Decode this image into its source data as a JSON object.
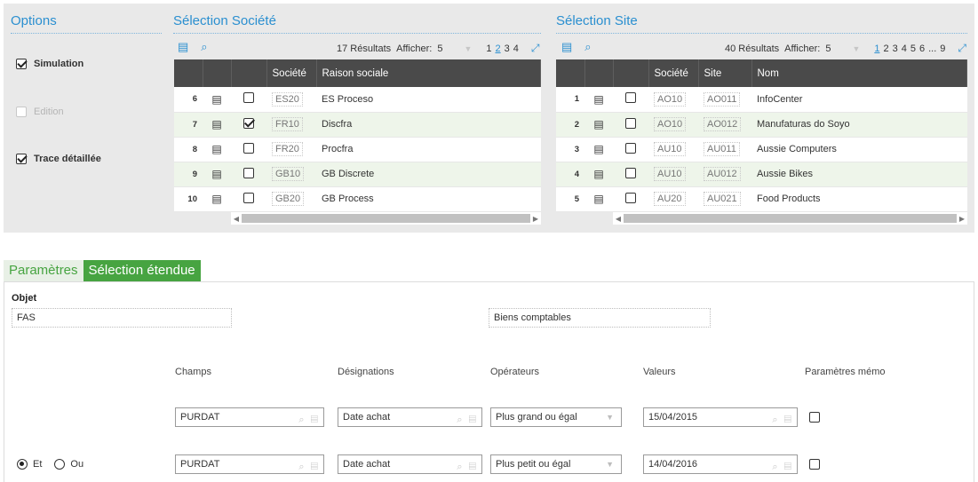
{
  "options": {
    "title": "Options",
    "items": [
      {
        "label": "Simulation",
        "checked": true,
        "enabled": true
      },
      {
        "label": "Edition",
        "checked": false,
        "enabled": false
      },
      {
        "label": "Trace détaillée",
        "checked": true,
        "enabled": true
      }
    ]
  },
  "societe": {
    "title": "Sélection Société",
    "results": "17 Résultats",
    "show_label": "Afficher:",
    "show_value": "5",
    "pages": [
      "1",
      "2",
      "3",
      "4"
    ],
    "current_page": "2",
    "columns": [
      "Société",
      "Raison sociale"
    ],
    "rows": [
      {
        "num": "6",
        "checked": false,
        "code": "ES20",
        "name": "ES Proceso"
      },
      {
        "num": "7",
        "checked": true,
        "code": "FR10",
        "name": "Discfra"
      },
      {
        "num": "8",
        "checked": false,
        "code": "FR20",
        "name": "Procfra"
      },
      {
        "num": "9",
        "checked": false,
        "code": "GB10",
        "name": "GB Discrete"
      },
      {
        "num": "10",
        "checked": false,
        "code": "GB20",
        "name": "GB Process"
      }
    ]
  },
  "site": {
    "title": "Sélection Site",
    "results": "40 Résultats",
    "show_label": "Afficher:",
    "show_value": "5",
    "pages": [
      "1",
      "2",
      "3",
      "4",
      "5",
      "6",
      "...",
      "9"
    ],
    "current_page": "1",
    "columns": [
      "Société",
      "Site",
      "Nom"
    ],
    "rows": [
      {
        "num": "1",
        "checked": false,
        "company": "AO10",
        "site": "AO011",
        "name": "InfoCenter"
      },
      {
        "num": "2",
        "checked": false,
        "company": "AO10",
        "site": "AO012",
        "name": "Manufaturas do Soyo"
      },
      {
        "num": "3",
        "checked": false,
        "company": "AU10",
        "site": "AU011",
        "name": "Aussie Computers"
      },
      {
        "num": "4",
        "checked": false,
        "company": "AU10",
        "site": "AU012",
        "name": "Aussie Bikes"
      },
      {
        "num": "5",
        "checked": false,
        "company": "AU20",
        "site": "AU021",
        "name": "Food Products"
      }
    ]
  },
  "tabs": [
    {
      "label": "Paramètres",
      "active": false
    },
    {
      "label": "Sélection étendue",
      "active": true
    }
  ],
  "objet": {
    "label": "Objet",
    "code": "FAS",
    "description": "Biens comptables"
  },
  "criteria": {
    "headers": [
      "Champs",
      "Désignations",
      "Opérateurs",
      "Valeurs",
      "Paramètres mémo"
    ],
    "rows": [
      {
        "champ": "PURDAT",
        "designation": "Date achat",
        "operateur": "Plus grand ou égal",
        "valeur": "15/04/2015",
        "memo": false
      },
      {
        "champ": "PURDAT",
        "designation": "Date achat",
        "operateur": "Plus petit ou égal",
        "valeur": "14/04/2016",
        "memo": false
      }
    ],
    "logic": {
      "et": "Et",
      "ou": "Ou",
      "selected": "Et"
    }
  },
  "colors": {
    "accent": "#2a8fd0",
    "tab_green": "#47a441",
    "header_dark": "#4a4a4a"
  }
}
